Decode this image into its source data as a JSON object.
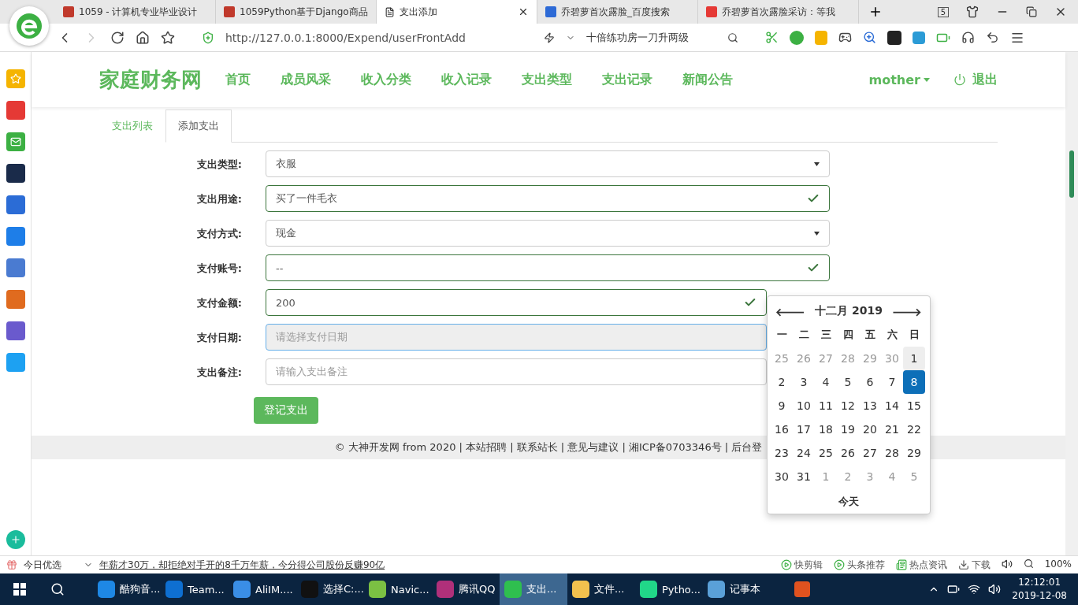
{
  "browser": {
    "tabs": [
      {
        "title": "1059 - 计算机专业毕业设计",
        "selected": false,
        "kind": "square"
      },
      {
        "title": "1059Python基于Django商品",
        "selected": false,
        "kind": "square"
      },
      {
        "title": "支出添加",
        "selected": true,
        "kind": "page"
      },
      {
        "title": "乔碧萝首次露脸_百度搜索",
        "selected": false,
        "kind": "paw"
      },
      {
        "title": "乔碧萝首次露脸采访：等我",
        "selected": false,
        "kind": "swirl"
      }
    ],
    "tab_count": "5",
    "url": "http://127.0.0.1:8000/Expend/userFrontAdd",
    "search_text": "十倍练功房一刀升两级"
  },
  "site": {
    "brand": "家庭财务网",
    "nav": [
      "首页",
      "成员风采",
      "收入分类",
      "收入记录",
      "支出类型",
      "支出记录",
      "新闻公告"
    ],
    "user": "mother",
    "logout": "退出"
  },
  "page_tabs": [
    {
      "label": "支出列表",
      "selected": false
    },
    {
      "label": "添加支出",
      "selected": true
    }
  ],
  "form": {
    "fields": [
      {
        "label": "支出类型:",
        "kind": "select",
        "value": "衣服"
      },
      {
        "label": "支出用途:",
        "kind": "input",
        "value": "买了一件毛衣",
        "valid": true
      },
      {
        "label": "支付方式:",
        "kind": "select",
        "value": "现金"
      },
      {
        "label": "支付账号:",
        "kind": "input",
        "value": "--",
        "valid": true
      },
      {
        "label": "支付金额:",
        "kind": "input",
        "value": "200",
        "valid": true
      },
      {
        "label": "支付日期:",
        "kind": "input",
        "placeholder": "请选择支付日期",
        "focused": true
      },
      {
        "label": "支出备注:",
        "kind": "input",
        "placeholder": "请输入支出备注"
      }
    ],
    "submit": "登记支出"
  },
  "footer": "© 大神开发网 from 2020 | 本站招聘 | 联系站长 | 意见与建议 | 湘ICP备0703346号 | 后台登",
  "datepicker": {
    "prev": "🡐",
    "title": "十二月 2019",
    "next": "🡒",
    "weekdays": [
      "一",
      "二",
      "三",
      "四",
      "五",
      "六",
      "日"
    ],
    "weeks": [
      [
        {
          "day": "25",
          "muted": true
        },
        {
          "day": "26",
          "muted": true
        },
        {
          "day": "27",
          "muted": true
        },
        {
          "day": "28",
          "muted": true
        },
        {
          "day": "29",
          "muted": true
        },
        {
          "day": "30",
          "muted": true
        },
        {
          "day": "1",
          "muted": false,
          "hover": true
        }
      ],
      [
        {
          "day": "2"
        },
        {
          "day": "3"
        },
        {
          "day": "4"
        },
        {
          "day": "5"
        },
        {
          "day": "6"
        },
        {
          "day": "7"
        },
        {
          "day": "8",
          "selected": true
        }
      ],
      [
        {
          "day": "9"
        },
        {
          "day": "10"
        },
        {
          "day": "11"
        },
        {
          "day": "12"
        },
        {
          "day": "13"
        },
        {
          "day": "14"
        },
        {
          "day": "15"
        }
      ],
      [
        {
          "day": "16"
        },
        {
          "day": "17"
        },
        {
          "day": "18"
        },
        {
          "day": "19"
        },
        {
          "day": "20"
        },
        {
          "day": "21"
        },
        {
          "day": "22"
        }
      ],
      [
        {
          "day": "23"
        },
        {
          "day": "24"
        },
        {
          "day": "25"
        },
        {
          "day": "26"
        },
        {
          "day": "27"
        },
        {
          "day": "28"
        },
        {
          "day": "29"
        }
      ],
      [
        {
          "day": "30"
        },
        {
          "day": "31"
        },
        {
          "day": "1",
          "muted": true
        },
        {
          "day": "2",
          "muted": true
        },
        {
          "day": "3",
          "muted": true
        },
        {
          "day": "4",
          "muted": true
        },
        {
          "day": "5",
          "muted": true
        }
      ]
    ],
    "today": "今天"
  },
  "status_bar": {
    "left": "今日优选",
    "news": "年薪才30万，却拒绝对手开的8千万年薪，今分得公司股份反赚90亿",
    "right": [
      {
        "label": "快剪辑",
        "kind": "play"
      },
      {
        "label": "头条推荐",
        "kind": "play"
      },
      {
        "label": "热点资讯",
        "kind": "news"
      },
      {
        "label": "下载",
        "kind": "download"
      }
    ],
    "zoom": "100%"
  },
  "taskbar": {
    "apps": [
      {
        "label": "酷狗音...",
        "selected": false,
        "color": "#1e88e5"
      },
      {
        "label": "Team...",
        "selected": false,
        "color": "#0e6fd1"
      },
      {
        "label": "AliIM....",
        "selected": false,
        "color": "#3a8ee6"
      },
      {
        "label": "选择C:...",
        "selected": false,
        "color": "#111111"
      },
      {
        "label": "Navic...",
        "selected": false,
        "color": "#7bc043"
      },
      {
        "label": "腾讯QQ",
        "selected": false,
        "color": "#b0307a"
      },
      {
        "label": "支出...",
        "selected": true,
        "color": "#2fbf4f"
      },
      {
        "label": "文件...",
        "selected": false,
        "color": "#f2c14e"
      },
      {
        "label": "Pytho...",
        "selected": false,
        "color": "#21d789"
      },
      {
        "label": "记事本",
        "selected": false,
        "color": "#5aa0d8"
      }
    ],
    "time": "12:12:01",
    "date": "2019-12-08"
  }
}
